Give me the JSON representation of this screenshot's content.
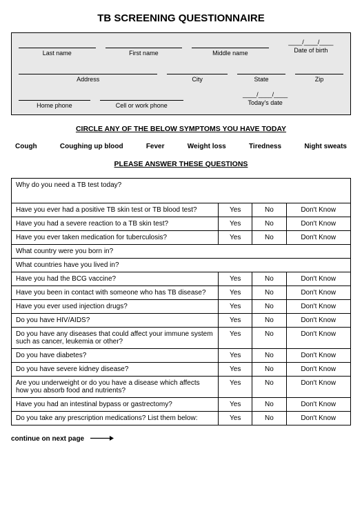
{
  "title": "TB SCREENING QUESTIONNAIRE",
  "header": {
    "last_name": "Last name",
    "first_name": "First name",
    "middle_name": "Middle name",
    "dob_value": "____/____/____",
    "dob": "Date of birth",
    "address": "Address",
    "city": "City",
    "state": "State",
    "zip": "Zip",
    "home_phone": "Home phone",
    "cell_phone": "Cell or work phone",
    "today_value": "____/____/____",
    "today": "Today's date"
  },
  "symptoms_head": "CIRCLE ANY OF THE BELOW SYMPTOMS YOU HAVE TODAY",
  "symptoms": [
    "Cough",
    "Coughing up blood",
    "Fever",
    "Weight loss",
    "Tiredness",
    "Night sweats"
  ],
  "questions_head": "PLEASE ANSWER THESE QUESTIONS",
  "opt": {
    "yes": "Yes",
    "no": "No",
    "dk": "Don't Know"
  },
  "questions": [
    {
      "q": "Why do you need a TB test today?",
      "type": "open_tall"
    },
    {
      "q": "Have you ever had a positive TB skin test or TB blood test?",
      "type": "yn"
    },
    {
      "q": "Have you had a severe reaction to a TB skin test?",
      "type": "yn"
    },
    {
      "q": "Have you ever taken medication  for tuberculosis?",
      "type": "yn"
    },
    {
      "q": "What country were you born in?",
      "type": "open"
    },
    {
      "q": "What countries have you lived in?",
      "type": "open"
    },
    {
      "q": "Have you had the BCG vaccine?",
      "type": "yn"
    },
    {
      "q": "Have you been in contact with someone who has TB disease?",
      "type": "yn"
    },
    {
      "q": "Have you ever used injection drugs?",
      "type": "yn"
    },
    {
      "q": "Do you have HIV/AIDS?",
      "type": "yn"
    },
    {
      "q": "Do you have any diseases that could affect your immune system such as cancer, leukemia or other?",
      "type": "yn"
    },
    {
      "q": "Do you have diabetes?",
      "type": "yn"
    },
    {
      "q": "Do you have severe kidney disease?",
      "type": "yn"
    },
    {
      "q": "Are you underweight or do you have a disease which affects how you absorb food and nutrients?",
      "type": "yn"
    },
    {
      "q": "Have you had an intestinal bypass or gastrectomy?",
      "type": "yn"
    },
    {
      "q": "Do you take any prescription medications?  List them below:",
      "type": "yn"
    }
  ],
  "continue": "continue on next page"
}
